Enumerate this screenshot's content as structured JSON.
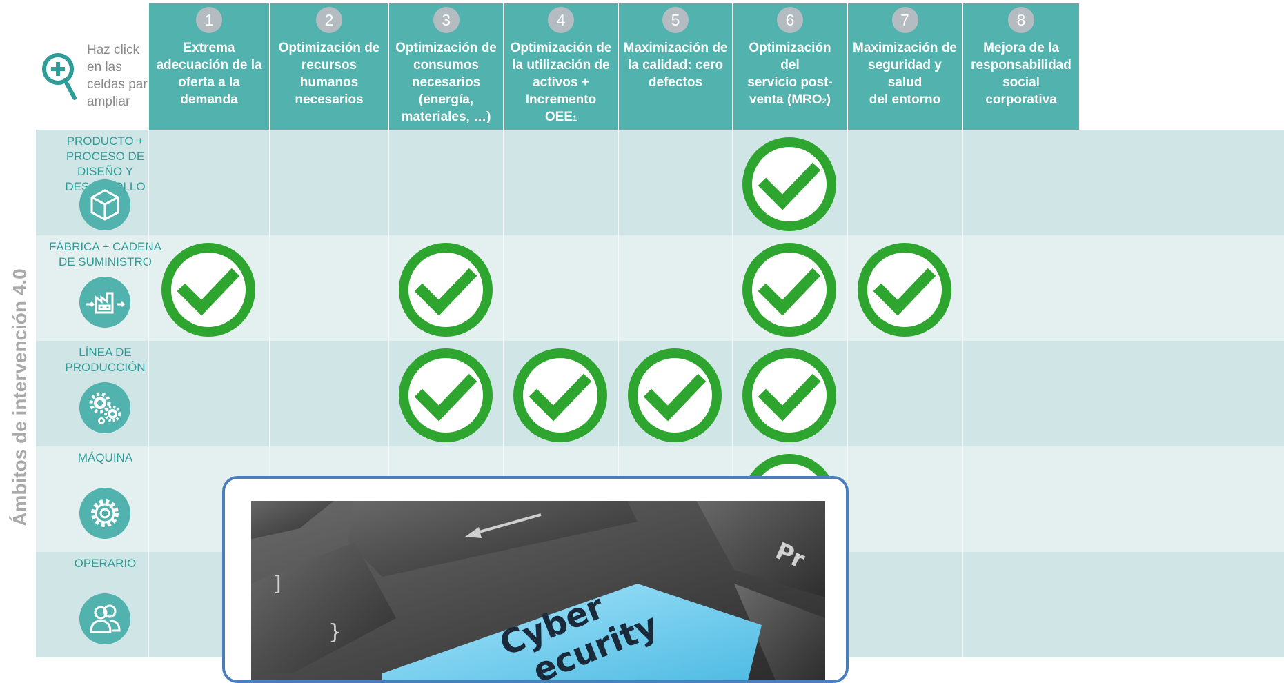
{
  "side_title": "Ámbitos de intervención 4.0",
  "corner": {
    "hint": "Haz click\nen las\nceldas para\nampliar",
    "icon": "zoom-plus-icon"
  },
  "columns": [
    {
      "num": "1",
      "label": "Extrema\nadecuación de la\noferta a la\ndemanda"
    },
    {
      "num": "2",
      "label": "Optimización de\nrecursos humanos\nnecesarios"
    },
    {
      "num": "3",
      "label": "Optimización  de\nconsumos\nnecesarios\n(energía,\nmateriales, …)"
    },
    {
      "num": "4",
      "label": "Optimización de\nla utilización de\nactivos +\nIncremento OEE",
      "sub": "1"
    },
    {
      "num": "5",
      "label": "Maximización de\nla calidad: cero\ndefectos"
    },
    {
      "num": "6",
      "label": "Optimización del\nservicio post-\nventa  (MRO",
      "sub": "2",
      "tail": ")"
    },
    {
      "num": "7",
      "label": "Maximización de\nseguridad y salud\ndel entorno"
    },
    {
      "num": "8",
      "label": "Mejora de la\nresponsabilidad\nsocial corporativa"
    }
  ],
  "rows": [
    {
      "label": "PRODUCTO +\nPROCESO DE\nDISEÑO Y\nDESARROLLO",
      "icon": "box-icon",
      "bg": "#d0e6e6"
    },
    {
      "label": "FÁBRICA + CADENA\nDE SUMINISTRO",
      "icon": "factory-icon",
      "bg": "#e4f0f0"
    },
    {
      "label": "LÍNEA DE\nPRODUCCIÓN",
      "icon": "gears-icon",
      "bg": "#d0e6e6"
    },
    {
      "label": "MÁQUINA",
      "icon": "gear-icon",
      "bg": "#e4f0f0"
    },
    {
      "label": "OPERARIO",
      "icon": "users-icon",
      "bg": "#d0e6e6"
    }
  ],
  "checks": [
    {
      "row": 1,
      "col": 6
    },
    {
      "row": 2,
      "col": 1
    },
    {
      "row": 2,
      "col": 3
    },
    {
      "row": 2,
      "col": 6
    },
    {
      "row": 2,
      "col": 7
    },
    {
      "row": 3,
      "col": 3
    },
    {
      "row": 3,
      "col": 4
    },
    {
      "row": 3,
      "col": 5
    },
    {
      "row": 3,
      "col": 6
    },
    {
      "row": 4,
      "col": 6
    }
  ],
  "colors": {
    "header_teal": "#52b2ae",
    "check_green": "#2ea52e",
    "badge_gray": "#b4bcc2",
    "popup_border": "#4a7fbf",
    "key_blue": "#7fd3f0"
  },
  "popup": {
    "key_line1": "Cyber",
    "key_line2": "ecurity",
    "key_corner": "Pr"
  }
}
